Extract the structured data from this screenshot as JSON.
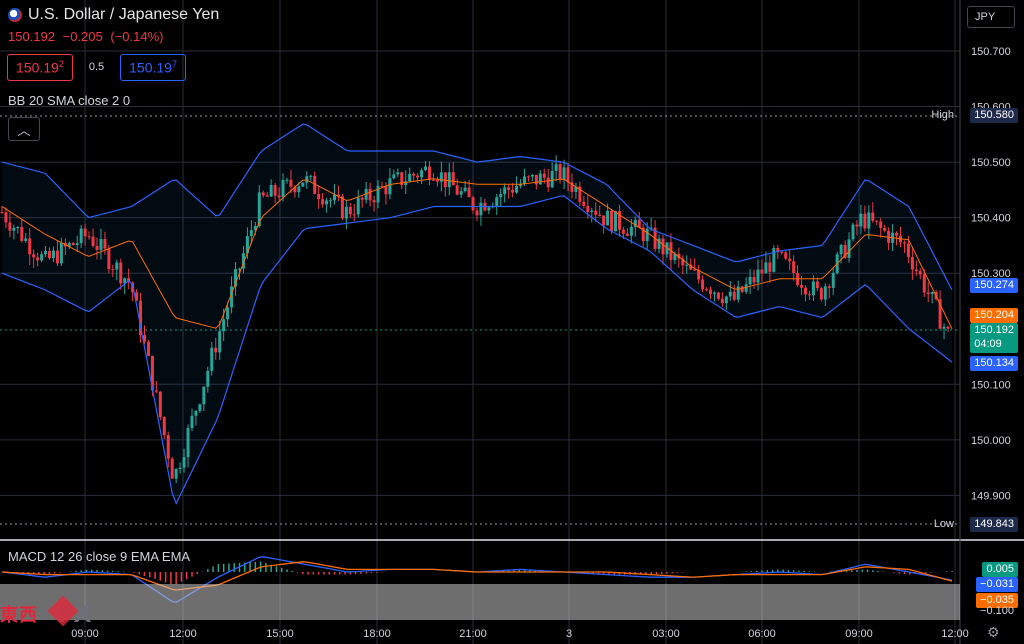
{
  "header": {
    "title": "U.S. Dollar / Japanese Yen",
    "last_price": "150.192",
    "change": "−0.205",
    "change_pct": "(−0.14%)",
    "bid_main": "150.19",
    "bid_sup": "2",
    "spread": "0.5",
    "ask_main": "150.19",
    "ask_sup": "7",
    "currency": "JPY",
    "collapse_icon": "chevron-up-icon"
  },
  "indicators": {
    "bb_label": "BB 20 SMA close 2 0",
    "macd_label": "MACD 12 26 close 9 EMA EMA"
  },
  "right_axis": {
    "ticks": [
      "150.700",
      "150.600",
      "150.500",
      "150.400",
      "150.300",
      "150.100",
      "150.000",
      "149.900"
    ],
    "tags": {
      "high_label": "High",
      "high_value": "150.580",
      "bb_upper": "150.274",
      "bb_basis": "150.204",
      "last": "150.192",
      "countdown": "04:09",
      "bb_lower": "150.134",
      "low_label": "Low",
      "low_value": "149.843"
    },
    "macd_tags": {
      "hist": "0.005",
      "macd": "−0.031",
      "signal": "−0.035",
      "axis_label": "−0.100"
    }
  },
  "time_axis": [
    "09:00",
    "12:00",
    "15:00",
    "18:00",
    "21:00",
    "3",
    "03:00",
    "06:00",
    "09:00",
    "12:00"
  ],
  "colors": {
    "up": "#26a69a",
    "down": "#f23645",
    "bb_band": "#2962ff",
    "bb_basis": "#ff6d00",
    "macd": "#2962ff",
    "signal": "#ff6d00"
  },
  "logo_text": {
    "kanji": "東西",
    "fx": "FX"
  },
  "settings_icon": "gear-icon",
  "chart_data": [
    {
      "type": "line",
      "title": "U.S. Dollar / Japanese Yen",
      "x": [
        "09:00",
        "12:00",
        "15:00",
        "18:00",
        "21:00",
        "3",
        "03:00",
        "06:00",
        "09:00",
        "12:00"
      ],
      "ylim": [
        149.83,
        150.72
      ],
      "series": [
        {
          "name": "close",
          "values": [
            150.41,
            150.32,
            150.37,
            150.28,
            149.93,
            150.18,
            150.43,
            150.47,
            150.41,
            150.46,
            150.49,
            150.42,
            150.46,
            150.48,
            150.4,
            150.37,
            150.3,
            150.25,
            150.33,
            150.26,
            150.4,
            150.35,
            150.19
          ]
        },
        {
          "name": "upper",
          "values": [
            150.5,
            150.48,
            150.4,
            150.42,
            150.47,
            150.4,
            150.52,
            150.57,
            150.52,
            150.52,
            150.52,
            150.5,
            150.51,
            150.5,
            150.46,
            150.38,
            150.35,
            150.32,
            150.34,
            150.35,
            150.47,
            150.42,
            150.27
          ]
        },
        {
          "name": "basis",
          "values": [
            150.42,
            150.37,
            150.33,
            150.36,
            150.22,
            150.2,
            150.4,
            150.47,
            150.43,
            150.46,
            150.47,
            150.46,
            150.46,
            150.47,
            150.42,
            150.37,
            150.31,
            150.27,
            150.29,
            150.29,
            150.37,
            150.36,
            150.2
          ]
        },
        {
          "name": "lower",
          "values": [
            150.3,
            150.27,
            150.23,
            150.29,
            149.88,
            150.04,
            150.28,
            150.38,
            150.39,
            150.4,
            150.42,
            150.42,
            150.42,
            150.44,
            150.38,
            150.34,
            150.27,
            150.22,
            150.24,
            150.22,
            150.28,
            150.2,
            150.14
          ]
        }
      ]
    },
    {
      "type": "line",
      "title": "MACD 12 26 close 9 EMA EMA",
      "x": [
        "09:00",
        "12:00",
        "15:00",
        "18:00",
        "21:00",
        "3",
        "03:00",
        "06:00",
        "09:00",
        "12:00"
      ],
      "series": [
        {
          "name": "macd",
          "values": [
            0.0,
            -0.02,
            0.0,
            -0.01,
            -0.12,
            -0.02,
            0.06,
            0.03,
            0.0,
            0.01,
            0.01,
            0.0,
            0.01,
            0.0,
            -0.01,
            -0.02,
            -0.02,
            -0.01,
            0.0,
            -0.01,
            0.03,
            0.0,
            -0.031
          ]
        },
        {
          "name": "signal",
          "values": [
            0.0,
            -0.01,
            -0.01,
            -0.01,
            -0.07,
            -0.05,
            0.02,
            0.04,
            0.01,
            0.01,
            0.01,
            0.0,
            0.0,
            0.0,
            0.0,
            -0.01,
            -0.02,
            -0.01,
            -0.01,
            -0.01,
            0.02,
            0.01,
            -0.035
          ]
        }
      ]
    }
  ]
}
